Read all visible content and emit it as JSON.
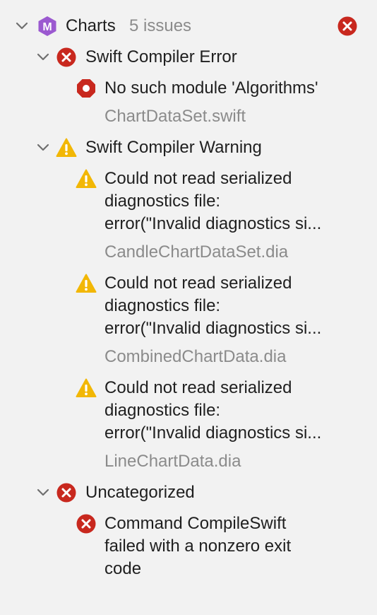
{
  "project": {
    "name": "Charts",
    "issue_count": "5 issues",
    "icon": "module-icon",
    "icon_letter": "M"
  },
  "groups": [
    {
      "title": "Swift Compiler Error",
      "icon": "error-icon",
      "issues": [
        {
          "icon": "stop-icon",
          "lines": [
            "No such module 'Algorithms'"
          ],
          "file": "ChartDataSet.swift"
        }
      ]
    },
    {
      "title": "Swift Compiler Warning",
      "icon": "warning-icon",
      "issues": [
        {
          "icon": "warning-icon",
          "lines": [
            "Could not read serialized",
            "diagnostics file:",
            "error(\"Invalid diagnostics si..."
          ],
          "file": "CandleChartDataSet.dia"
        },
        {
          "icon": "warning-icon",
          "lines": [
            "Could not read serialized",
            "diagnostics file:",
            "error(\"Invalid diagnostics si..."
          ],
          "file": "CombinedChartData.dia"
        },
        {
          "icon": "warning-icon",
          "lines": [
            "Could not read serialized",
            "diagnostics file:",
            "error(\"Invalid diagnostics si..."
          ],
          "file": "LineChartData.dia"
        }
      ]
    },
    {
      "title": "Uncategorized",
      "icon": "error-icon",
      "issues": [
        {
          "icon": "error-icon",
          "lines": [
            "Command CompileSwift",
            "failed with a nonzero exit",
            "code"
          ]
        }
      ]
    }
  ],
  "colors": {
    "error": "#c8281e",
    "warning": "#f2b705",
    "module": "#9b59d0",
    "secondary_text": "#8b8b8b"
  }
}
